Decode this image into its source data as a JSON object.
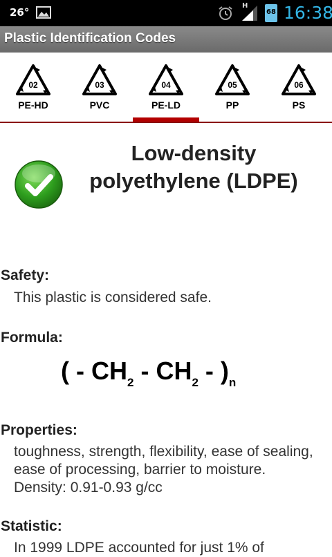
{
  "status_bar": {
    "temperature": "26°",
    "network": "H",
    "battery": "68",
    "time": "16:38"
  },
  "app": {
    "title": "Plastic Identification Codes"
  },
  "codes": [
    {
      "num": "02",
      "abbr": "PE-HD"
    },
    {
      "num": "03",
      "abbr": "PVC"
    },
    {
      "num": "04",
      "abbr": "PE-LD"
    },
    {
      "num": "05",
      "abbr": "PP"
    },
    {
      "num": "06",
      "abbr": "PS"
    }
  ],
  "selected_code": "04",
  "detail": {
    "title": "Low-density polyethylene (LDPE)",
    "safety_label": "Safety:",
    "safety_text": "This plastic is considered safe.",
    "formula_label": "Formula:",
    "formula_parts": {
      "open": "( - CH",
      "sub1": "2",
      "mid": " - CH",
      "sub2": "2",
      "close": " - )",
      "subn": "n"
    },
    "properties_label": "Properties:",
    "properties_text": "toughness, strength, flexibility, ease of sealing, ease of processing, barrier to moisture. Density: 0.91-0.93 g/cc",
    "statistic_label": "Statistic:",
    "statistic_text": "In 1999 LDPE accounted for just 1% of"
  },
  "colors": {
    "accent": "#b30000",
    "clock": "#33b5e5",
    "check_green": "#2e9e1e"
  }
}
